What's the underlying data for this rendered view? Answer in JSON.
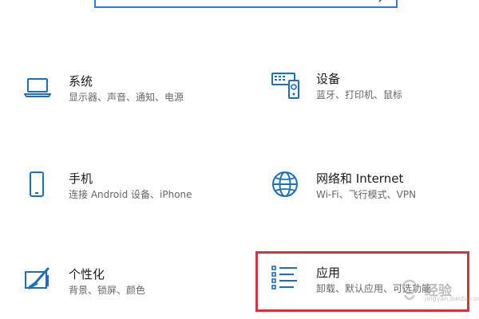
{
  "search": {
    "placeholder": ""
  },
  "tiles": [
    {
      "title": "系统",
      "desc": "显示器、声音、通知、电源",
      "icon": "laptop-icon"
    },
    {
      "title": "设备",
      "desc": "蓝牙、打印机、鼠标",
      "icon": "keyboard-devices-icon"
    },
    {
      "title": "手机",
      "desc": "连接 Android 设备、iPhone",
      "icon": "phone-icon"
    },
    {
      "title": "网络和 Internet",
      "desc": "Wi-Fi、飞行模式、VPN",
      "icon": "globe-icon"
    },
    {
      "title": "个性化",
      "desc": "背景、锁屏、颜色",
      "icon": "paint-icon"
    },
    {
      "title": "应用",
      "desc": "卸载、默认应用、可选功能",
      "icon": "apps-list-icon"
    }
  ],
  "watermark": {
    "text": "经验",
    "sub": "jingyan.baidu.com"
  },
  "colors": {
    "accent": "#1a6fc4",
    "highlight": "#d8323a"
  }
}
